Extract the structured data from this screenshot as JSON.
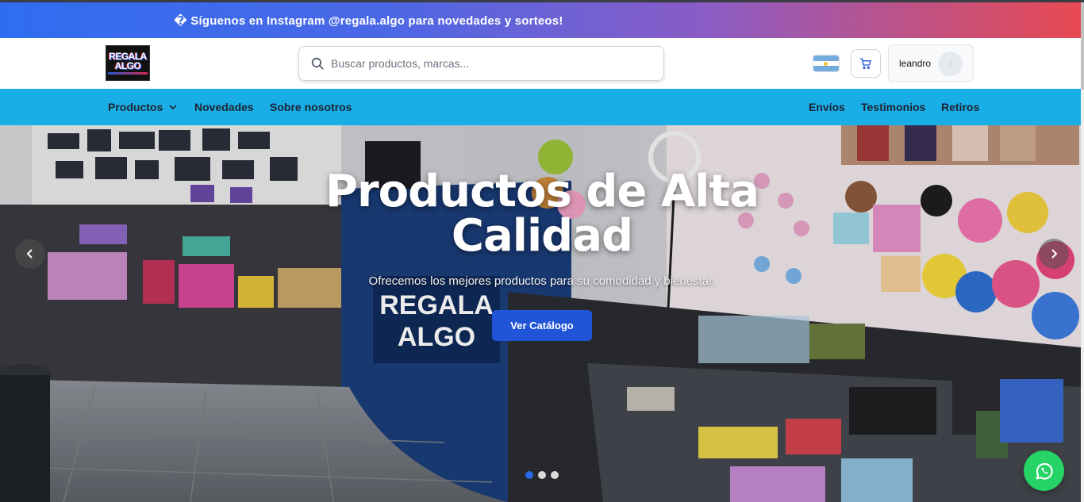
{
  "announcement": {
    "text": "� Síguenos en Instagram @regala.algo para novedades y sorteos!"
  },
  "header": {
    "logo_line1": "REGALA",
    "logo_line2": "ALGO",
    "search_placeholder": "Buscar productos, marcas...",
    "country_flag": "argentina-flag",
    "user_name": "leandro",
    "avatar_initial": "l"
  },
  "nav": {
    "left": [
      "Productos",
      "Novedades",
      "Sobre nosotros"
    ],
    "right": [
      "Envíos",
      "Testimonios",
      "Retiros"
    ]
  },
  "hero": {
    "title_line1": "Productos de Alta",
    "title_line2": "Calidad",
    "subtitle": "Ofrecemos los mejores productos para su comodidad y bienestar.",
    "cta_label": "Ver Catálogo",
    "slides_count": 3,
    "active_slide": 1
  },
  "colors": {
    "announce_start": "#2f6df0",
    "announce_end": "#e84a52",
    "nav_bg": "#1aaee6",
    "cta_bg": "#1f55d6",
    "whatsapp": "#25d366"
  },
  "icons": [
    "search-icon",
    "cart-icon",
    "chevron-down-icon",
    "chevron-left-icon",
    "chevron-right-icon",
    "whatsapp-icon"
  ]
}
